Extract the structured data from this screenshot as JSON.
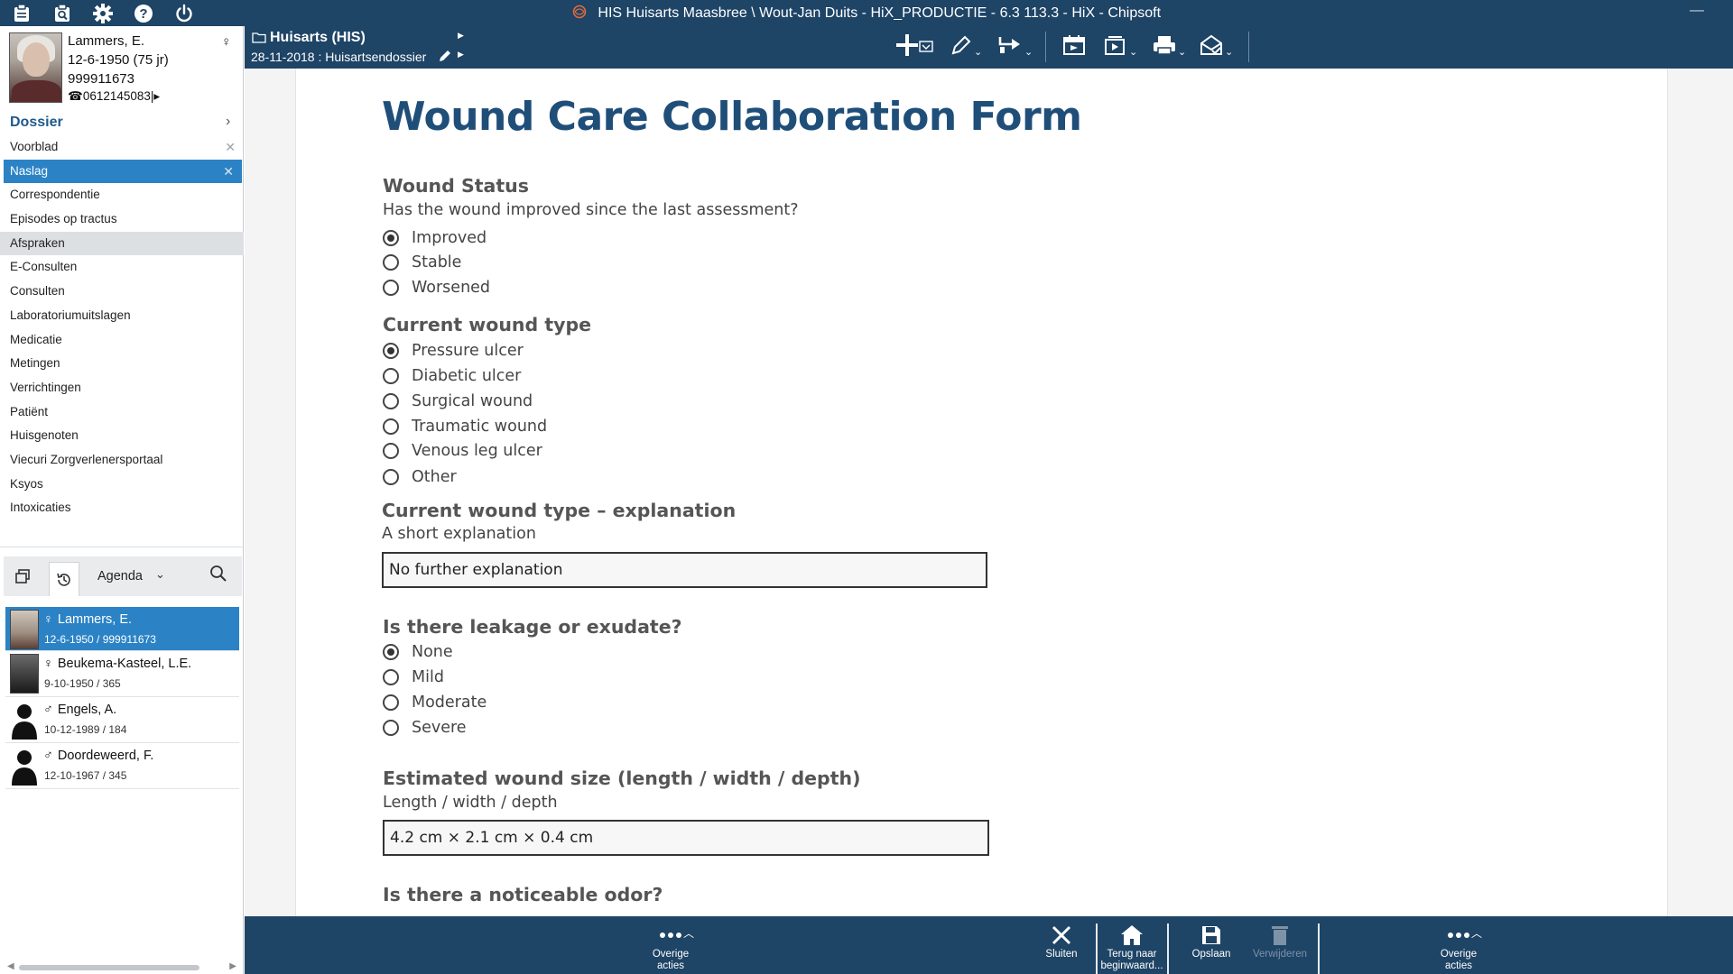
{
  "window": {
    "title": "HIS Huisarts Maasbree \\ Wout-Jan Duits - HiX_PRODUCTIE - 6.3 113.3 - HiX - Chipsoft",
    "minimize": "—"
  },
  "titlebar_icons": [
    "clipboard-icon",
    "search-doc-icon",
    "gear-icon",
    "help-icon",
    "power-icon"
  ],
  "patient": {
    "name": "Lammers, E.",
    "dob": "12-6-1950 (75 jr)",
    "bsn": "999911673",
    "phone": "0612145083",
    "gender_symbol": "♀"
  },
  "dossier": {
    "label": "Dossier",
    "items": [
      {
        "label": "Voorblad",
        "closable": true
      },
      {
        "label": "Naslag",
        "closable": true,
        "active": true
      },
      {
        "label": "Correspondentie"
      },
      {
        "label": "Episodes op tractus"
      },
      {
        "label": "Afspraken",
        "hover": true
      },
      {
        "label": "E-Consulten"
      },
      {
        "label": "Consulten"
      },
      {
        "label": "Laboratoriumuitslagen"
      },
      {
        "label": "Medicatie"
      },
      {
        "label": "Metingen"
      },
      {
        "label": "Verrichtingen"
      },
      {
        "label": "Patiënt"
      },
      {
        "label": "Huisgenoten"
      },
      {
        "label": "Viecuri Zorgverlenersportaal"
      },
      {
        "label": "Ksyos"
      },
      {
        "label": "Intoxicaties"
      }
    ]
  },
  "agenda": {
    "label": "Agenda"
  },
  "patient_list": [
    {
      "gender": "♀",
      "name": "Lammers, E.",
      "sub": "12-6-1950 / 999911673",
      "selected": true
    },
    {
      "gender": "♀",
      "name": "Beukema-Kasteel, L.E.",
      "sub": "9-10-1950 / 365"
    },
    {
      "gender": "♂",
      "name": "Engels, A.",
      "sub": "10-12-1989 / 184"
    },
    {
      "gender": "♂",
      "name": "Doordeweerd, F.",
      "sub": "12-10-1967 / 345"
    }
  ],
  "folder": {
    "title": "Huisarts (HIS)",
    "subtitle": "28-11-2018 : Huisartsendossier"
  },
  "toolbar_tools": [
    "add-icon",
    "pen-icon",
    "transfer-icon",
    "calendar-icon",
    "play-icon",
    "print-icon",
    "mail-icon"
  ],
  "form": {
    "title": "Wound Care Collaboration Form",
    "q1": {
      "title": "Wound Status",
      "subtitle": "Has the wound improved since the last assessment?",
      "options": [
        "Improved",
        "Stable",
        "Worsened"
      ],
      "selected": 0
    },
    "q2": {
      "title": "Current wound type",
      "options": [
        "Pressure ulcer",
        "Diabetic ulcer",
        "Surgical wound",
        "Traumatic wound",
        "Venous leg ulcer",
        "Other"
      ],
      "selected": 0
    },
    "q3": {
      "title": "Current wound type – explanation",
      "subtitle": "A short explanation",
      "value": "No further explanation"
    },
    "q4": {
      "title": "Is there leakage or exudate?",
      "options": [
        "None",
        "Mild",
        "Moderate",
        "Severe"
      ],
      "selected": 0
    },
    "q5": {
      "title": "Estimated wound size (length / width / depth)",
      "subtitle": "Length / width / depth",
      "value": "4.2 cm × 2.1 cm × 0.4 cm"
    },
    "q6": {
      "title": "Is there a noticeable odor?"
    }
  },
  "bottom": {
    "more_left": "Overige acties",
    "close": "Sluiten",
    "home": "Terug naar beginwaard...",
    "save": "Opslaan",
    "delete": "Verwijderen",
    "more_right": "Overige acties"
  },
  "colors": {
    "header_bg": "#1e4466",
    "accent": "#2b83c6",
    "form_title": "#1f4e79"
  }
}
